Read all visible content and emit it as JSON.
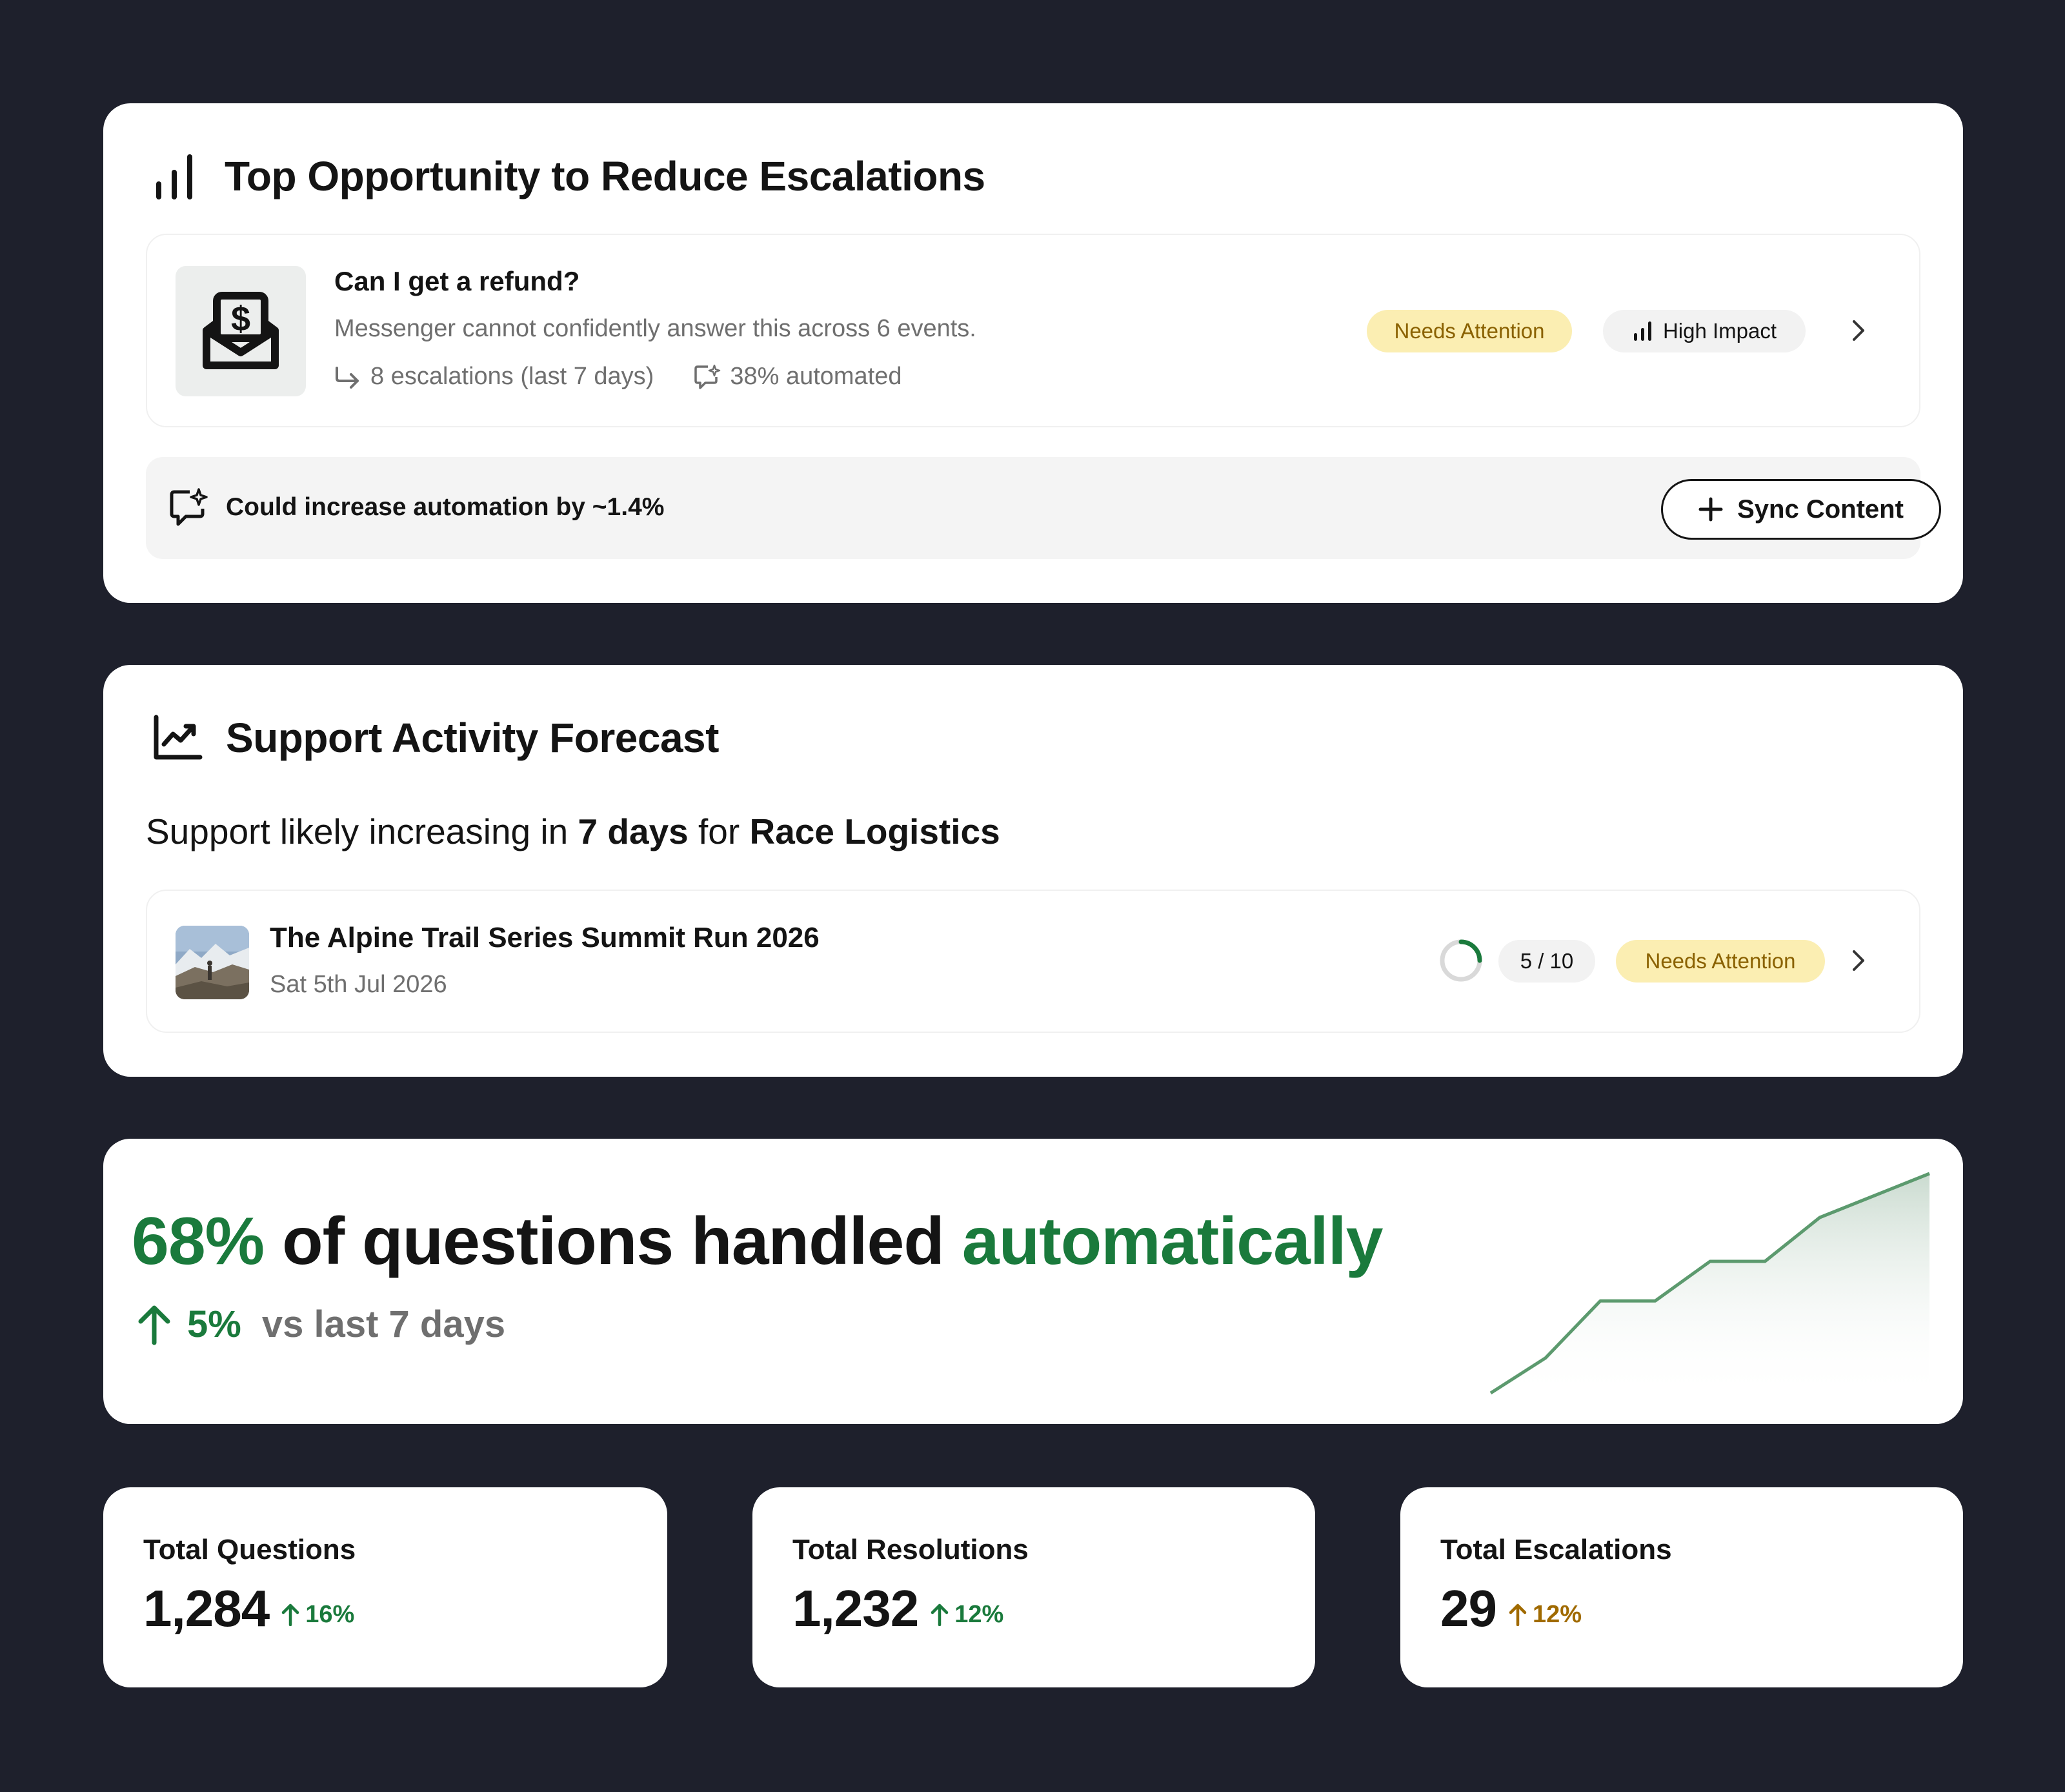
{
  "opportunity": {
    "title": "Top Opportunity to Reduce Escalations",
    "title_icon": "bar-chart-icon",
    "question": {
      "icon": "refund-envelope-icon",
      "title": "Can I get a refund?",
      "description": "Messenger cannot confidently answer this across 6 events.",
      "escalations": "8 escalations (last 7 days)",
      "automated": "38% automated",
      "badge_attention": "Needs Attention",
      "badge_impact": "High Impact"
    },
    "automation_hint": "Could increase automation by ~1.4%",
    "sync_button": "Sync Content"
  },
  "forecast": {
    "title": "Support Activity Forecast",
    "title_icon": "trend-chart-icon",
    "line": {
      "prefix": "Support likely increasing in",
      "days": "7 days",
      "mid": "for",
      "category": "Race Logistics"
    },
    "event": {
      "title": "The Alpine Trail Series Summit Run 2026",
      "date": "Sat 5th Jul 2026",
      "progress": 0.5,
      "count": "5 / 10",
      "badge": "Needs Attention"
    }
  },
  "automation": {
    "percent": "68%",
    "middle": "of questions handled",
    "tail": "automatically",
    "delta": "5%",
    "delta_label": "vs last 7 days",
    "trend": [
      0,
      0.16,
      0.42,
      0.42,
      0.6,
      0.6,
      0.8,
      0.9,
      1.0
    ]
  },
  "stats": [
    {
      "label": "Total Questions",
      "value": "1,284",
      "delta": "16%",
      "tone": "green"
    },
    {
      "label": "Total Resolutions",
      "value": "1,232",
      "delta": "12%",
      "tone": "green"
    },
    {
      "label": "Total Escalations",
      "value": "29",
      "delta": "12%",
      "tone": "amber"
    }
  ],
  "colors": {
    "background": "#1e202c",
    "accent_green": "#1a7a3c",
    "attention_bg": "#fbeeb2",
    "attention_text": "#8a6100",
    "amber": "#a06a00"
  }
}
